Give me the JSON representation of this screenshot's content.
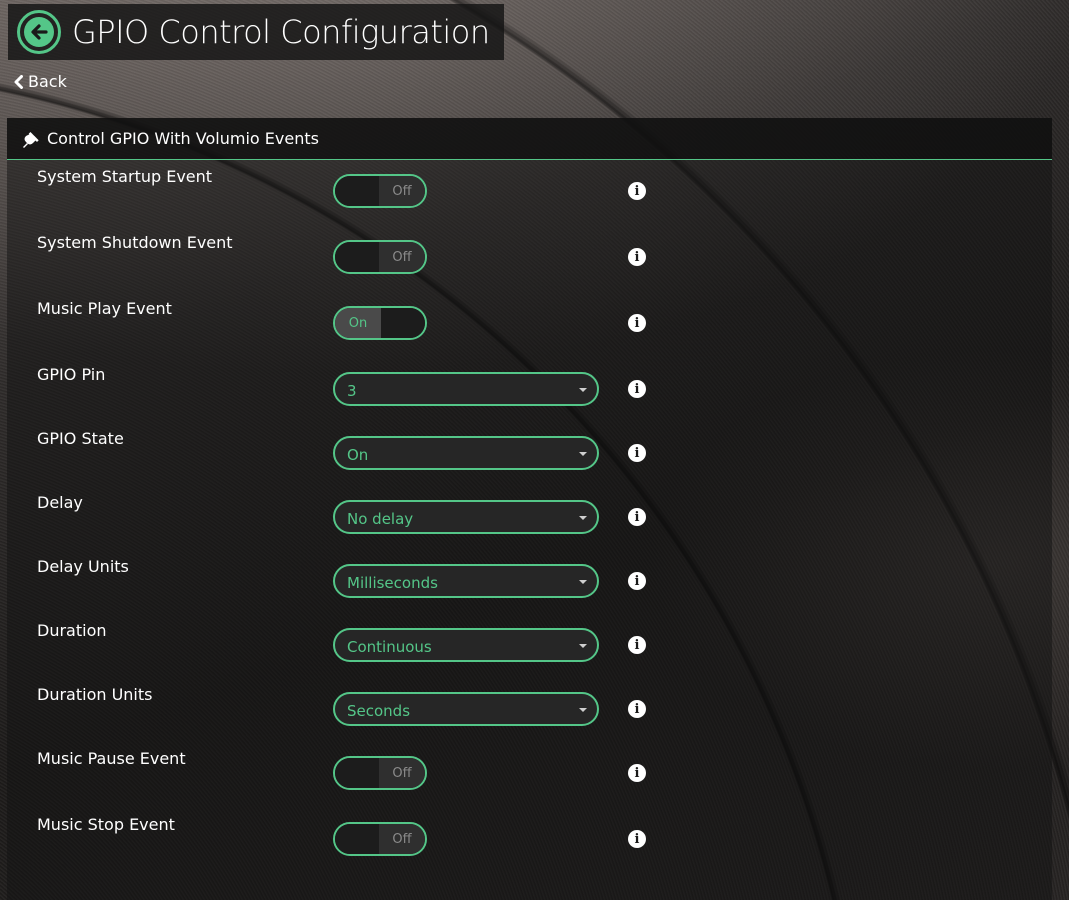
{
  "header": {
    "title": "GPIO Control Configuration",
    "back_icon": "arrow-left-circle-icon"
  },
  "back_link": {
    "label": "Back",
    "icon": "chevron-left-icon"
  },
  "section": {
    "title": "Control GPIO With Volumio Events",
    "icon": "plug-icon"
  },
  "accent_color": "#54c688",
  "fields": {
    "startup": {
      "label": "System Startup Event",
      "state": "Off"
    },
    "shutdown": {
      "label": "System Shutdown Event",
      "state": "Off"
    },
    "play": {
      "label": "Music Play Event",
      "state": "On"
    },
    "gpio_pin": {
      "label": "GPIO Pin",
      "value": "3"
    },
    "gpio_state": {
      "label": "GPIO State",
      "value": "On"
    },
    "delay": {
      "label": "Delay",
      "value": "No delay"
    },
    "delay_units": {
      "label": "Delay Units",
      "value": "Milliseconds"
    },
    "duration": {
      "label": "Duration",
      "value": "Continuous"
    },
    "duration_units": {
      "label": "Duration Units",
      "value": "Seconds"
    },
    "pause": {
      "label": "Music Pause Event",
      "state": "Off"
    },
    "stop": {
      "label": "Music Stop Event",
      "state": "Off"
    }
  },
  "info_icon": "info-circle-icon"
}
